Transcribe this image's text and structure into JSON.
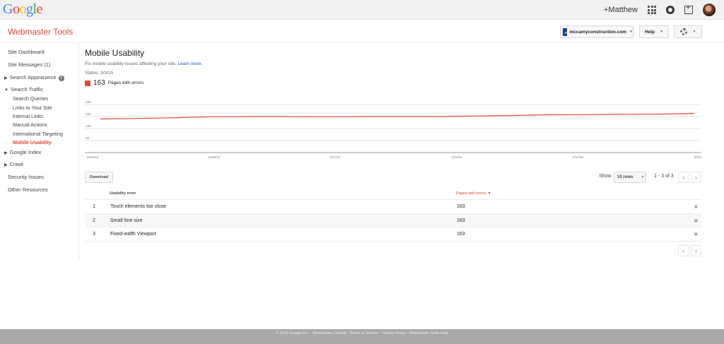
{
  "gbar": {
    "logo_letters": [
      {
        "ch": "G",
        "color": "#4285f4"
      },
      {
        "ch": "o",
        "color": "#ea4335"
      },
      {
        "ch": "o",
        "color": "#fbbc05"
      },
      {
        "ch": "g",
        "color": "#4285f4"
      },
      {
        "ch": "l",
        "color": "#34a853"
      },
      {
        "ch": "e",
        "color": "#ea4335"
      }
    ],
    "user": "+Matthew"
  },
  "header": {
    "title": "Webmaster Tools",
    "site": "mccamyconstruction.com",
    "help": "Help"
  },
  "sidebar": {
    "items": [
      {
        "label": "Site Dashboard"
      },
      {
        "label": "Site Messages (1)"
      },
      {
        "label": "Search Appearance"
      },
      {
        "label": "Search Traffic"
      },
      {
        "label": "Search Queries"
      },
      {
        "label": "Links to Your Site"
      },
      {
        "label": "Internal Links"
      },
      {
        "label": "Manual Actions"
      },
      {
        "label": "International Targeting"
      },
      {
        "label": "Mobile Usability"
      },
      {
        "label": "Google Index"
      },
      {
        "label": "Crawl"
      },
      {
        "label": "Security Issues"
      },
      {
        "label": "Other Resources"
      }
    ]
  },
  "main": {
    "title": "Mobile Usability",
    "subtitle": "Fix mobile usability issues affecting your site.",
    "learn_more": "Learn more.",
    "status": "Status: 3/3/15",
    "legend_count": "163",
    "legend_label": "Pages with errors",
    "download": "Download",
    "show_label": "Show",
    "rows_value": "10 rows",
    "range": "1 - 3 of 3"
  },
  "chart_data": {
    "type": "line",
    "series": [
      {
        "name": "Pages with errors",
        "color": "#dd4b39",
        "values": [
          140,
          142,
          145,
          149,
          150,
          150,
          149,
          150,
          150,
          150,
          152,
          154,
          157,
          158,
          159,
          160,
          163
        ]
      }
    ],
    "x_tick_labels": [
      "12/16/14",
      "12/30/14",
      "1/17/15",
      "1/31/15",
      "2/17/15",
      "3/3/15"
    ],
    "y_tick_labels": [
      "200",
      "150",
      "100",
      "50"
    ],
    "ylim": [
      0,
      200
    ],
    "grid": true
  },
  "table": {
    "headers": {
      "col1": "Usability error",
      "col2": "Pages with errors"
    },
    "rows": [
      {
        "num": "1",
        "error": "Touch elements too close",
        "pages": "163"
      },
      {
        "num": "2",
        "error": "Small font size",
        "pages": "163"
      },
      {
        "num": "3",
        "error": "Fixed-width Viewport",
        "pages": "163"
      }
    ]
  },
  "footer": "© 2015 Google Inc. - Webmaster Central - Terms of Service - Privacy Policy - Webmaster Tools Help"
}
